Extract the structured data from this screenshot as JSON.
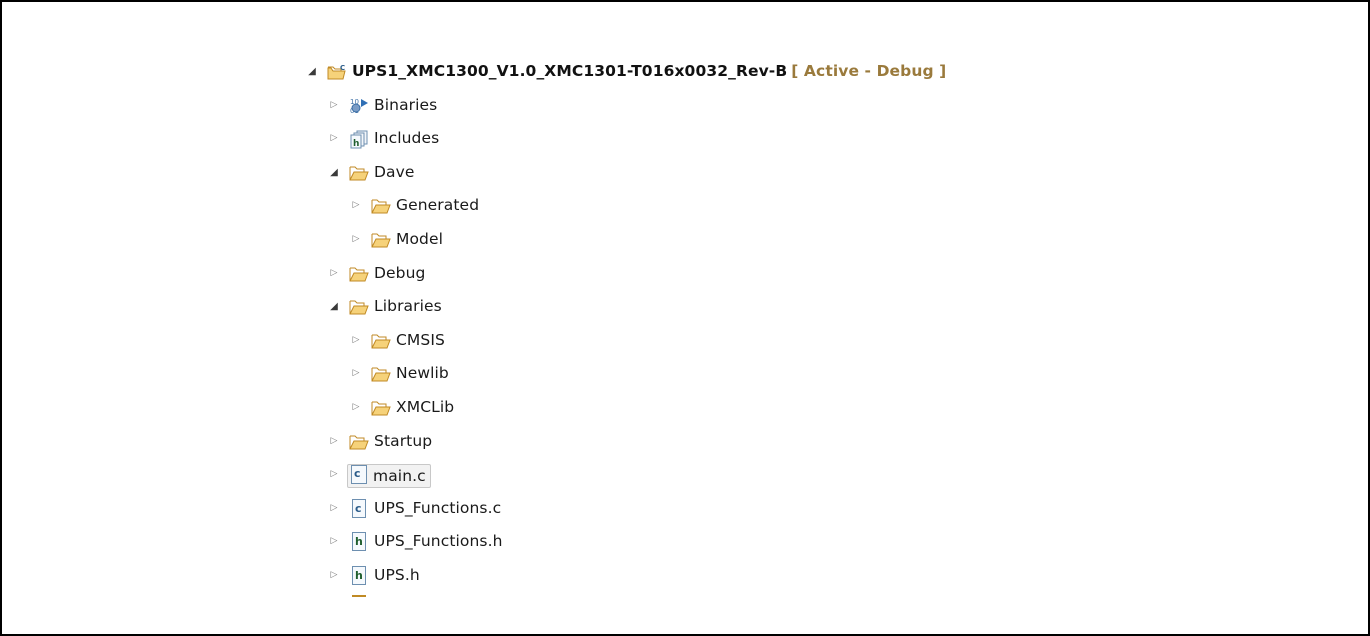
{
  "project": {
    "name": "UPS1_XMC1300_V1.0_XMC1301-T016x0032_Rev-B",
    "badge": "[ Active - Debug ]"
  },
  "tree": {
    "binaries": "Binaries",
    "includes": "Includes",
    "dave": "Dave",
    "generated": "Generated",
    "model": "Model",
    "debug": "Debug",
    "libraries": "Libraries",
    "cmsis": "CMSIS",
    "newlib": "Newlib",
    "xmclib": "XMCLib",
    "startup": "Startup",
    "main_c": "main.c",
    "ups_functions_c": "UPS_Functions.c",
    "ups_functions_h": "UPS_Functions.h",
    "ups_h": "UPS.h"
  },
  "colors": {
    "badge": "#9a7a3c",
    "folder_fill": "#f6d27a",
    "folder_stroke": "#c08a24",
    "c_letter": "#2b5c8a",
    "h_letter": "#1f5e2e"
  }
}
